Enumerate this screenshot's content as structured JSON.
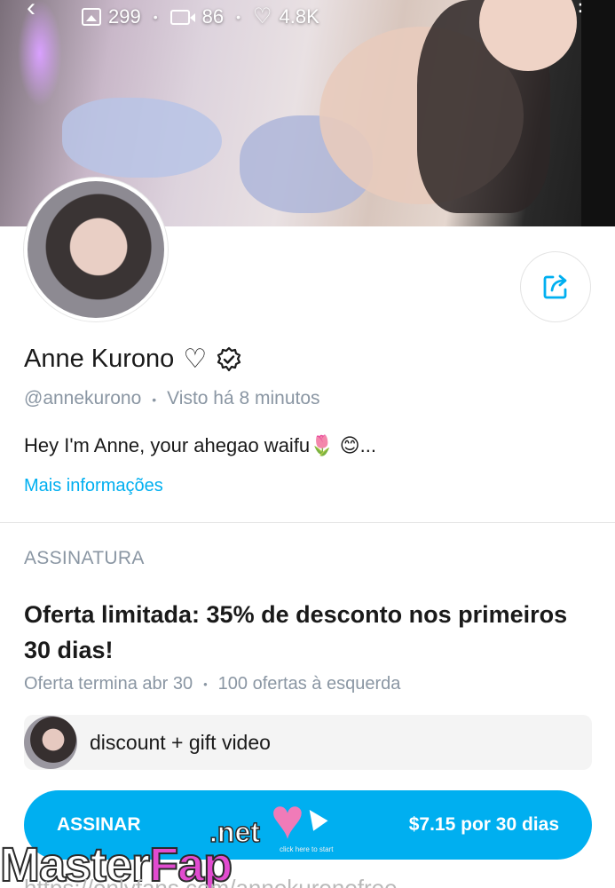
{
  "cover": {
    "stats": {
      "images": "299",
      "videos": "86",
      "likes": "4.8K"
    }
  },
  "profile": {
    "name": "Anne Kurono",
    "handle": "@annekurono",
    "last_seen": "Visto há 8 minutos",
    "bio": "Hey I'm Anne, your ahegao waifu🌷 😊...",
    "more_info": "Mais informações"
  },
  "subscription": {
    "section_label": "ASSINATURA",
    "offer_title": "Oferta limitada: 35% de desconto nos pri­meiros 30 dias!",
    "offer_ends": "Oferta termina abr 30",
    "offers_left": "100 ofertas à esquerda",
    "promo_message": "discount + gift video",
    "subscribe_label": "ASSINAR",
    "price_label": "$7.15 por 30 dias"
  },
  "watermark": {
    "brand_main": "Master",
    "brand_accent": "Fap",
    "brand_tld": ".net",
    "caption": "click here to start"
  },
  "url_strip": "https://onlyfans.com/annekuronofree",
  "colors": {
    "accent": "#00aff0",
    "muted": "#8a96a3"
  },
  "icons": [
    "back-icon",
    "more-icon",
    "image-icon",
    "video-icon",
    "heart-icon",
    "share-icon",
    "verified-icon"
  ]
}
